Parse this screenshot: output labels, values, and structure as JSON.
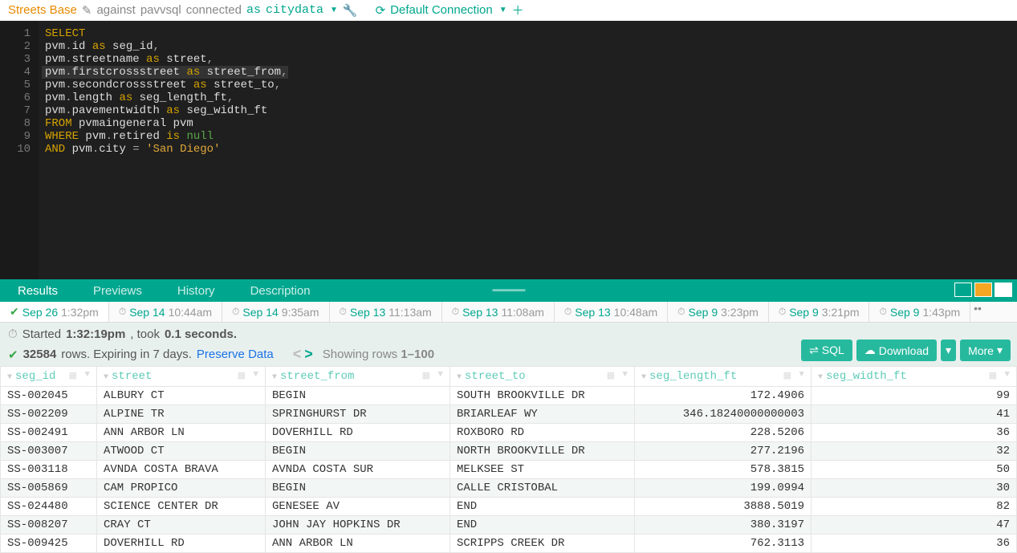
{
  "topbar": {
    "query_name": "Streets Base",
    "against_label": "against",
    "server": "pavvsql",
    "status": "connected",
    "as_label": "as",
    "db": "citydata",
    "connection": "Default Connection"
  },
  "editor": {
    "line_numbers": [
      "1",
      "2",
      "3",
      "4",
      "5",
      "6",
      "7",
      "8",
      "9",
      "10"
    ],
    "lines": [
      [
        {
          "t": "SELECT",
          "c": "kw"
        }
      ],
      [
        {
          "t": "pvm",
          "c": "ident"
        },
        {
          "t": ".",
          "c": "punct"
        },
        {
          "t": "id ",
          "c": "ident"
        },
        {
          "t": "as",
          "c": "kw"
        },
        {
          "t": " seg_id",
          "c": "ident"
        },
        {
          "t": ",",
          "c": "punct"
        }
      ],
      [
        {
          "t": "pvm",
          "c": "ident"
        },
        {
          "t": ".",
          "c": "punct"
        },
        {
          "t": "streetname ",
          "c": "ident"
        },
        {
          "t": "as",
          "c": "kw"
        },
        {
          "t": " street",
          "c": "ident"
        },
        {
          "t": ",",
          "c": "punct"
        }
      ],
      [
        {
          "t": "pvm",
          "c": "ident"
        },
        {
          "t": ".",
          "c": "punct"
        },
        {
          "t": "firstcrossstreet ",
          "c": "ident"
        },
        {
          "t": "as",
          "c": "kw"
        },
        {
          "t": " street_from",
          "c": "ident"
        },
        {
          "t": ",",
          "c": "punct"
        }
      ],
      [
        {
          "t": "pvm",
          "c": "ident"
        },
        {
          "t": ".",
          "c": "punct"
        },
        {
          "t": "secondcrossstreet ",
          "c": "ident"
        },
        {
          "t": "as",
          "c": "kw"
        },
        {
          "t": " street_to",
          "c": "ident"
        },
        {
          "t": ",",
          "c": "punct"
        }
      ],
      [
        {
          "t": "pvm",
          "c": "ident"
        },
        {
          "t": ".",
          "c": "punct"
        },
        {
          "t": "length ",
          "c": "ident"
        },
        {
          "t": "as",
          "c": "kw"
        },
        {
          "t": " seg_length_ft",
          "c": "ident"
        },
        {
          "t": ",",
          "c": "punct"
        }
      ],
      [
        {
          "t": "pvm",
          "c": "ident"
        },
        {
          "t": ".",
          "c": "punct"
        },
        {
          "t": "pavementwidth ",
          "c": "ident"
        },
        {
          "t": "as",
          "c": "kw"
        },
        {
          "t": " seg_width_ft",
          "c": "ident"
        }
      ],
      [
        {
          "t": "FROM",
          "c": "kw"
        },
        {
          "t": " pvmaingeneral pvm",
          "c": "ident"
        }
      ],
      [
        {
          "t": "WHERE",
          "c": "kw"
        },
        {
          "t": " pvm",
          "c": "ident"
        },
        {
          "t": ".",
          "c": "punct"
        },
        {
          "t": "retired ",
          "c": "ident"
        },
        {
          "t": "is",
          "c": "kw"
        },
        {
          "t": " ",
          "c": "ident"
        },
        {
          "t": "null",
          "c": "null"
        }
      ],
      [
        {
          "t": "AND",
          "c": "kw"
        },
        {
          "t": " pvm",
          "c": "ident"
        },
        {
          "t": ".",
          "c": "punct"
        },
        {
          "t": "city ",
          "c": "ident"
        },
        {
          "t": "=",
          "c": "punct"
        },
        {
          "t": " ",
          "c": "ident"
        },
        {
          "t": "'San Diego'",
          "c": "str"
        }
      ]
    ],
    "highlighted_line": 3
  },
  "panel_tabs": [
    "Results",
    "Previews",
    "History",
    "Description"
  ],
  "run_tabs": [
    {
      "date": "Sep 26",
      "time": "1:32pm",
      "active": true,
      "icon": "check"
    },
    {
      "date": "Sep 14",
      "time": "10:44am"
    },
    {
      "date": "Sep 14",
      "time": "9:35am"
    },
    {
      "date": "Sep 13",
      "time": "11:13am"
    },
    {
      "date": "Sep 13",
      "time": "11:08am"
    },
    {
      "date": "Sep 13",
      "time": "10:48am"
    },
    {
      "date": "Sep 9",
      "time": "3:23pm"
    },
    {
      "date": "Sep 9",
      "time": "3:21pm"
    },
    {
      "date": "Sep 9",
      "time": "1:43pm"
    }
  ],
  "status": {
    "started_label": "Started",
    "started_time": "1:32:19pm",
    "took_label": ", took",
    "took_value": "0.1 seconds.",
    "row_count": "32584",
    "rows_suffix": "rows. Expiring in 7 days.",
    "preserve": "Preserve Data",
    "showing": "Showing rows",
    "range": "1–100"
  },
  "actions": {
    "sql": "⇌ SQL",
    "download": "Download",
    "more": "More"
  },
  "table": {
    "columns": [
      "seg_id",
      "street",
      "street_from",
      "street_to",
      "seg_length_ft",
      "seg_width_ft"
    ],
    "rows": [
      [
        "SS-002045",
        "ALBURY CT",
        "BEGIN",
        "SOUTH BROOKVILLE DR",
        "172.4906",
        "99"
      ],
      [
        "SS-002209",
        "ALPINE TR",
        "SPRINGHURST DR",
        "BRIARLEAF WY",
        "346.18240000000003",
        "41"
      ],
      [
        "SS-002491",
        "ANN ARBOR LN",
        "DOVERHILL RD",
        "ROXBORO RD",
        "228.5206",
        "36"
      ],
      [
        "SS-003007",
        "ATWOOD CT",
        "BEGIN",
        "NORTH BROOKVILLE DR",
        "277.2196",
        "32"
      ],
      [
        "SS-003118",
        "AVNDA COSTA BRAVA",
        "AVNDA COSTA SUR",
        "MELKSEE ST",
        "578.3815",
        "50"
      ],
      [
        "SS-005869",
        "CAM PROPICO",
        "BEGIN",
        "CALLE CRISTOBAL",
        "199.0994",
        "30"
      ],
      [
        "SS-024480",
        "SCIENCE CENTER DR",
        "GENESEE AV",
        "END",
        "3888.5019",
        "82"
      ],
      [
        "SS-008207",
        "CRAY CT",
        "JOHN JAY HOPKINS DR",
        "END",
        "380.3197",
        "47"
      ],
      [
        "SS-009425",
        "DOVERHILL RD",
        "ANN ARBOR LN",
        "SCRIPPS CREEK DR",
        "762.3113",
        "36"
      ]
    ]
  }
}
